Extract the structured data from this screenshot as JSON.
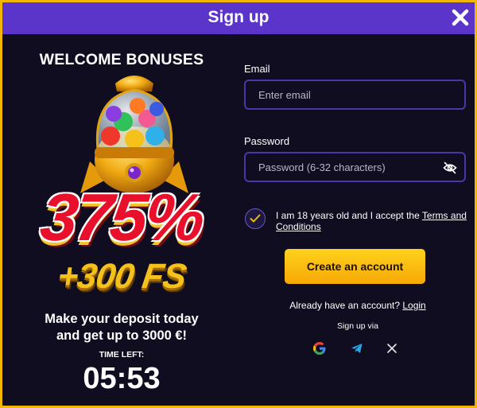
{
  "header": {
    "title": "Sign up"
  },
  "promo": {
    "title": "WELCOME BONUSES",
    "percent": "375%",
    "free_spins": "+300 FS",
    "deposit_line1": "Make your deposit today",
    "deposit_line2": "and get up to 3000 €!",
    "time_label": "TIME LEFT:",
    "timer": "05:53"
  },
  "form": {
    "email_label": "Email",
    "email_placeholder": "Enter email",
    "email_value": "",
    "password_label": "Password",
    "password_placeholder": "Password (6-32 characters)",
    "password_value": "",
    "age_checked": true,
    "terms_text": "I am 18 years old and I accept the ",
    "terms_link": "Terms and Conditions",
    "create_button": "Create an account",
    "have_account_text": "Already have an account? ",
    "login_link": "Login",
    "signup_via": "Sign up via"
  },
  "social_icons": [
    "google-icon",
    "telegram-icon",
    "x-icon"
  ],
  "colors": {
    "header_bg": "#5b35c9",
    "modal_bg": "#0f0d1f",
    "frame": "#f2b705",
    "field_border": "#4b36a8",
    "button_gradient_top": "#ffd21c",
    "button_gradient_bottom": "#f6a805",
    "percent_red": "#e8102a",
    "fs_gold": "#f4c21b"
  }
}
